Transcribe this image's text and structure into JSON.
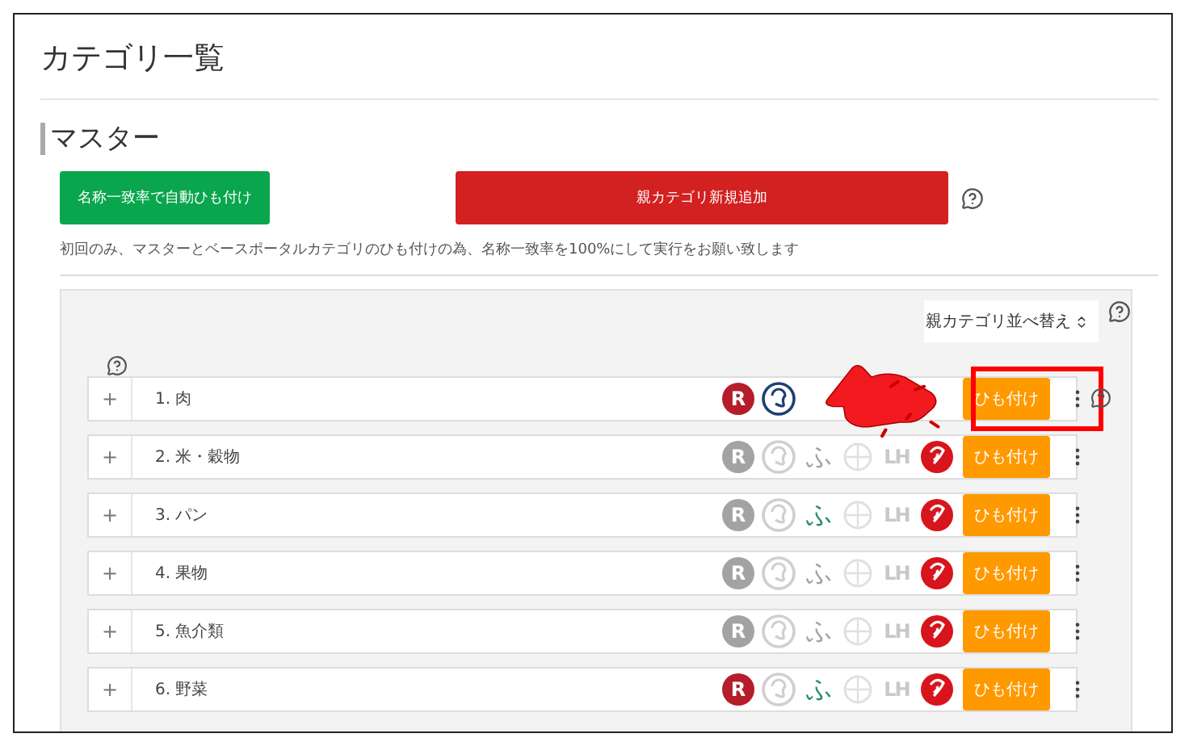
{
  "page_title": "カテゴリ一覧",
  "section_title": "マスター",
  "buttons": [
    {
      "label": "名称一致率で自動ひも付け",
      "kind": "green"
    },
    {
      "label": "親カテゴリ新規追加",
      "kind": "red"
    }
  ],
  "note": "初回のみ、マスターとベースポータルカテゴリのひも付けの為、名称一致率を100%にして実行をお願い致します",
  "sort_select": {
    "value": "親カテゴリ並べ替え"
  },
  "categories": [
    {
      "toggle": "+",
      "name": "1. 肉",
      "link_button": "ひも付け",
      "highlighted": true,
      "portals": [
        {
          "kind": "rakuten",
          "glyph": "R",
          "on": true
        },
        {
          "kind": "bird",
          "on": true
        }
      ]
    },
    {
      "toggle": "+",
      "name": "2. 米・穀物",
      "link_button": "ひも付け",
      "highlighted": false,
      "portals": [
        {
          "kind": "rakuten",
          "glyph": "R",
          "on": false
        },
        {
          "kind": "bird",
          "on": false
        },
        {
          "kind": "fu",
          "glyph": "ふ",
          "on": false
        },
        {
          "kind": "globe"
        },
        {
          "kind": "lh",
          "glyph": "LH"
        },
        {
          "kind": "crane"
        }
      ]
    },
    {
      "toggle": "+",
      "name": "3. パン",
      "link_button": "ひも付け",
      "highlighted": false,
      "portals": [
        {
          "kind": "rakuten",
          "glyph": "R",
          "on": false
        },
        {
          "kind": "bird",
          "on": false
        },
        {
          "kind": "fu",
          "glyph": "ふ",
          "on": true
        },
        {
          "kind": "globe"
        },
        {
          "kind": "lh",
          "glyph": "LH"
        },
        {
          "kind": "crane"
        }
      ]
    },
    {
      "toggle": "+",
      "name": "4. 果物",
      "link_button": "ひも付け",
      "highlighted": false,
      "portals": [
        {
          "kind": "rakuten",
          "glyph": "R",
          "on": false
        },
        {
          "kind": "bird",
          "on": false
        },
        {
          "kind": "fu",
          "glyph": "ふ",
          "on": false
        },
        {
          "kind": "globe"
        },
        {
          "kind": "lh",
          "glyph": "LH"
        },
        {
          "kind": "crane"
        }
      ]
    },
    {
      "toggle": "+",
      "name": "5. 魚介類",
      "link_button": "ひも付け",
      "highlighted": false,
      "portals": [
        {
          "kind": "rakuten",
          "glyph": "R",
          "on": false
        },
        {
          "kind": "bird",
          "on": false
        },
        {
          "kind": "fu",
          "glyph": "ふ",
          "on": false
        },
        {
          "kind": "globe"
        },
        {
          "kind": "lh",
          "glyph": "LH"
        },
        {
          "kind": "crane"
        }
      ]
    },
    {
      "toggle": "+",
      "name": "6. 野菜",
      "link_button": "ひも付け",
      "highlighted": false,
      "portals": [
        {
          "kind": "rakuten",
          "glyph": "R",
          "on": true
        },
        {
          "kind": "bird",
          "on": false
        },
        {
          "kind": "fu",
          "glyph": "ふ",
          "on": true
        },
        {
          "kind": "globe"
        },
        {
          "kind": "lh",
          "glyph": "LH"
        },
        {
          "kind": "crane"
        }
      ]
    }
  ],
  "annotation": {
    "kind": "pointer"
  }
}
